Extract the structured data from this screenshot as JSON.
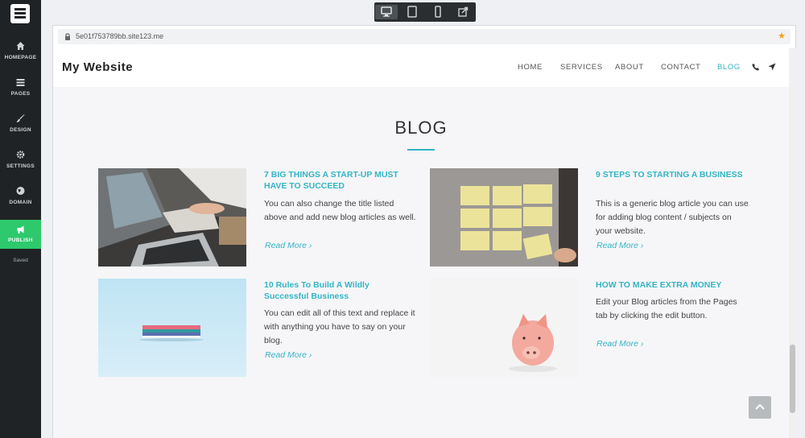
{
  "editor": {
    "nav": [
      {
        "label": "HOMEPAGE",
        "icon": "home-icon"
      },
      {
        "label": "PAGES",
        "icon": "pages-icon"
      },
      {
        "label": "DESIGN",
        "icon": "brush-icon"
      },
      {
        "label": "SETTINGS",
        "icon": "gear-icon"
      },
      {
        "label": "DOMAIN",
        "icon": "globe-icon"
      },
      {
        "label": "PUBLISH",
        "icon": "megaphone-icon"
      }
    ],
    "status": "Saved",
    "accent": "#2ec96c",
    "devices": [
      "desktop-icon",
      "tablet-icon",
      "mobile-icon",
      "external-link-icon"
    ]
  },
  "browser": {
    "url": "5e01f753789bb.site123.me"
  },
  "site": {
    "name": "My Website",
    "menu": [
      "HOME",
      "SERVICES",
      "ABOUT",
      "CONTACT",
      "BLOG"
    ],
    "active_menu": "BLOG",
    "accent": "#33b5c5",
    "section_title": "BLOG",
    "posts": [
      {
        "title": "7 BIG THINGS A START-UP MUST HAVE TO SUCCEED",
        "body": "You can also change the title listed above and add new blog articles as well.",
        "link": "Read More ›",
        "image": "laptops-meeting"
      },
      {
        "title": "9 STEPS TO STARTING A BUSINESS",
        "body": "This is a generic blog article you can use for adding blog content / subjects on your website.",
        "link": "Read More ›",
        "image": "sticky-notes"
      },
      {
        "title": "10 Rules To Build A Wildly Successful Business",
        "body": "You can edit all of this text and replace it with anything you have to say on your blog.",
        "link": "Read More ›",
        "image": "notebooks"
      },
      {
        "title": "HOW TO MAKE EXTRA MONEY",
        "body": "Edit your Blog articles from the Pages tab by clicking the edit button.",
        "link": "Read More ›",
        "image": "piggy-bank"
      }
    ]
  }
}
